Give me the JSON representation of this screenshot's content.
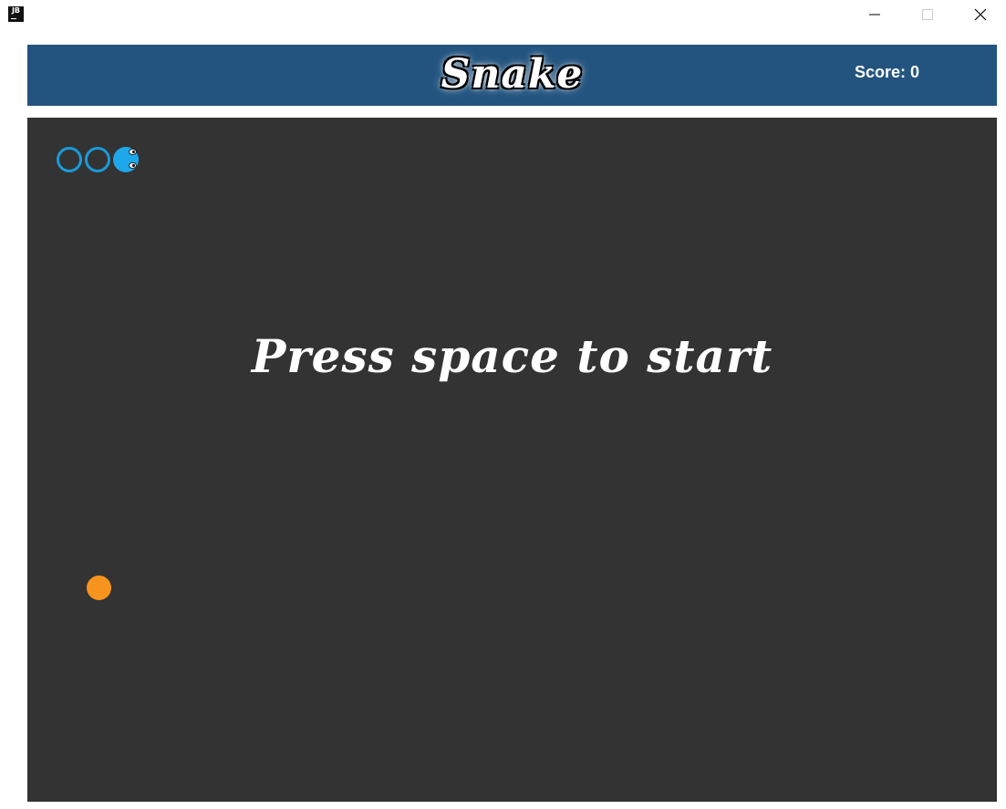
{
  "window": {
    "app_icon_text": "JB",
    "controls": [
      {
        "name": "minimize",
        "icon": "minimize-icon"
      },
      {
        "name": "maximize",
        "icon": "maximize-icon"
      },
      {
        "name": "close",
        "icon": "close-icon"
      }
    ]
  },
  "header": {
    "title": "Snake",
    "score_label": "Score: 0",
    "background_color": "#23547f"
  },
  "board": {
    "background_color": "#333333",
    "prompt": "Press space to start",
    "snake": {
      "color": "#1ea7ea",
      "segments": 3,
      "facing": "right"
    },
    "food": {
      "color": "#f7941d"
    }
  }
}
